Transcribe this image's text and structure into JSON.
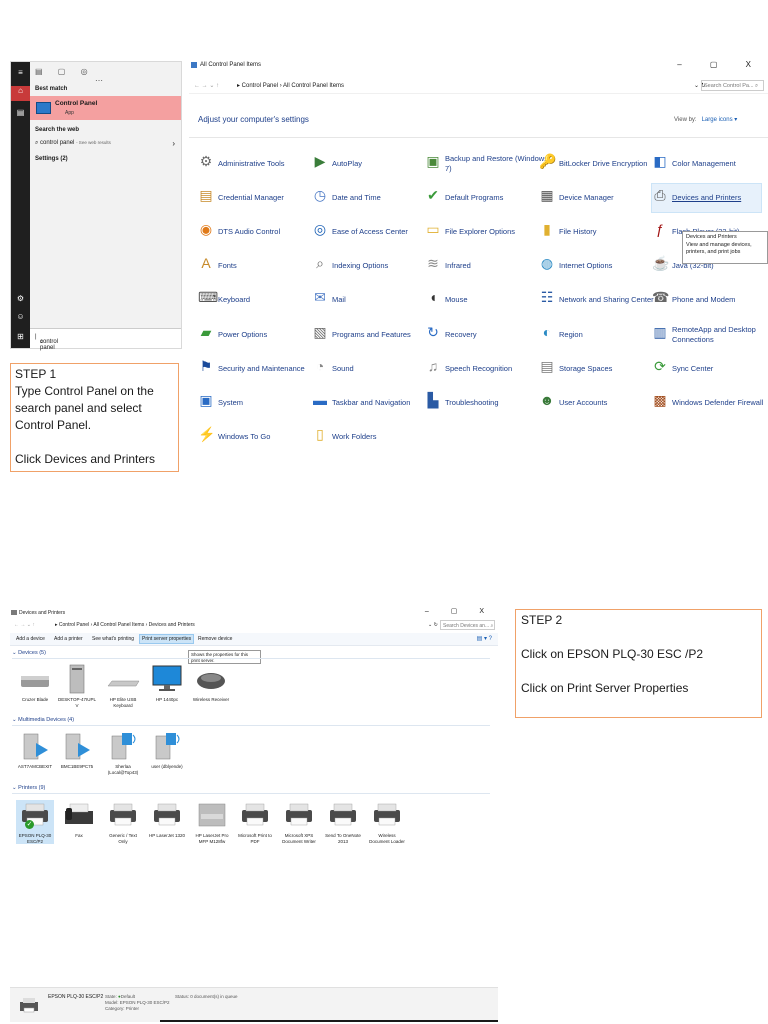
{
  "start_menu": {
    "top_icons": [
      "▤",
      "▢",
      "◎",
      "⋯"
    ],
    "best_match_label": "Best match",
    "best_match_title": "Control Panel",
    "best_match_sub": "App",
    "search_web_label": "Search the web",
    "web_result": "control panel",
    "web_result_sub": "- See web results",
    "settings_label": "Settings (2)",
    "search_value": "control panel"
  },
  "step1": {
    "heading": "STEP 1",
    "line1": "Type Control Panel on the search panel and select Control Panel.",
    "line2": "Click Devices and Printers"
  },
  "step2": {
    "heading": "STEP 2",
    "line1": "Click on  EPSON PLQ-30 ESC /P2",
    "line2": "Click on Print Server Properties"
  },
  "control_panel": {
    "window_title": "All Control Panel Items",
    "window_controls": "– ▢ X",
    "nav": "← → ⌄ ↑",
    "path": "▸ Control Panel › All Control Panel Items",
    "addr_controls": "⌄ ↻",
    "search_placeholder": "Search Control Pa... ⌕",
    "heading": "Adjust your computer's settings",
    "view_by_label": "View by:",
    "view_by_value": "Large icons ▾",
    "items": [
      {
        "label": "Administrative Tools",
        "glyph": "⚙",
        "color": "#6a6a6a"
      },
      {
        "label": "AutoPlay",
        "glyph": "▶",
        "color": "#3a7d3a"
      },
      {
        "label": "Backup and Restore (Windows 7)",
        "glyph": "▣",
        "color": "#4a8a3a"
      },
      {
        "label": "BitLocker Drive Encryption",
        "glyph": "🔑",
        "color": "#8a8a8a"
      },
      {
        "label": "Color Management",
        "glyph": "◧",
        "color": "#2a6bc4"
      },
      {
        "label": "Credential Manager",
        "glyph": "▤",
        "color": "#c78a2a"
      },
      {
        "label": "Date and Time",
        "glyph": "◷",
        "color": "#4a78c4"
      },
      {
        "label": "Default Programs",
        "glyph": "✔",
        "color": "#3a9a3a"
      },
      {
        "label": "Device Manager",
        "glyph": "▦",
        "color": "#555"
      },
      {
        "label": "Devices and Printers",
        "glyph": "⎙",
        "color": "#555"
      },
      {
        "label": "DTS Audio Control",
        "glyph": "◉",
        "color": "#e07a1a"
      },
      {
        "label": "Ease of Access Center",
        "glyph": "◎",
        "color": "#1a5fb4"
      },
      {
        "label": "File Explorer Options",
        "glyph": "▭",
        "color": "#e0b030"
      },
      {
        "label": "File History",
        "glyph": "▮",
        "color": "#e0b030"
      },
      {
        "label": "Flash Player (32-bit)",
        "glyph": "ƒ",
        "color": "#a01010"
      },
      {
        "label": "Fonts",
        "glyph": "A",
        "color": "#c78a2a"
      },
      {
        "label": "Indexing Options",
        "glyph": "⌕",
        "color": "#6a6a6a"
      },
      {
        "label": "Infrared",
        "glyph": "≋",
        "color": "#888"
      },
      {
        "label": "Internet Options",
        "glyph": "◍",
        "color": "#2a8ac4"
      },
      {
        "label": "Java (32-bit)",
        "glyph": "☕",
        "color": "#c04a1a"
      },
      {
        "label": "Keyboard",
        "glyph": "⌨",
        "color": "#555"
      },
      {
        "label": "Mail",
        "glyph": "✉",
        "color": "#4a78c4"
      },
      {
        "label": "Mouse",
        "glyph": "◖",
        "color": "#333"
      },
      {
        "label": "Network and Sharing Center",
        "glyph": "☷",
        "color": "#2a5aa4"
      },
      {
        "label": "Phone and Modem",
        "glyph": "☎",
        "color": "#666"
      },
      {
        "label": "Power Options",
        "glyph": "▰",
        "color": "#3a9a3a"
      },
      {
        "label": "Programs and Features",
        "glyph": "▧",
        "color": "#6a6a6a"
      },
      {
        "label": "Recovery",
        "glyph": "↻",
        "color": "#2a6bc4"
      },
      {
        "label": "Region",
        "glyph": "◐",
        "color": "#2a8ac4"
      },
      {
        "label": "RemoteApp and Desktop Connections",
        "glyph": "▥",
        "color": "#2a5aa4"
      },
      {
        "label": "Security and Maintenance",
        "glyph": "⚑",
        "color": "#1a4a9a"
      },
      {
        "label": "Sound",
        "glyph": "◔",
        "color": "#888"
      },
      {
        "label": "Speech Recognition",
        "glyph": "♫",
        "color": "#888"
      },
      {
        "label": "Storage Spaces",
        "glyph": "▤",
        "color": "#777"
      },
      {
        "label": "Sync Center",
        "glyph": "⟳",
        "color": "#3a9a3a"
      },
      {
        "label": "System",
        "glyph": "▣",
        "color": "#2a6bc4"
      },
      {
        "label": "Taskbar and Navigation",
        "glyph": "▬",
        "color": "#2a6bc4"
      },
      {
        "label": "Troubleshooting",
        "glyph": "▙",
        "color": "#2a5aa4"
      },
      {
        "label": "User Accounts",
        "glyph": "☻",
        "color": "#3a7a3a"
      },
      {
        "label": "Windows Defender Firewall",
        "glyph": "▩",
        "color": "#a04a1a"
      },
      {
        "label": "Windows To Go",
        "glyph": "⚡",
        "color": "#1a5fb4"
      },
      {
        "label": "Work Folders",
        "glyph": "▯",
        "color": "#e0b030"
      }
    ],
    "tooltip_title": "Devices and Printers",
    "tooltip_text": "View and manage devices, printers, and print jobs"
  },
  "devices_printers": {
    "window_title": "Devices and Printers",
    "window_controls": "– ▢ X",
    "nav": "← → ⌄ ↑",
    "path": "▸ Control Panel › All Control Panel Items › Devices and Printers",
    "addr_controls": "⌄ ↻",
    "search_placeholder": "Search Devices an... ⌕",
    "commands": [
      "Add a device",
      "Add a printer",
      "See what's printing",
      "Print server properties",
      "Remove device"
    ],
    "cmd_right": "▤ ▾   ?",
    "server_tip": "Shows the properties for this print server.",
    "groups": {
      "devices": "⌄ Devices (5)",
      "multimedia": "⌄ Multimedia Devices (4)",
      "printers": "⌄ Printers (9)"
    },
    "devices": [
      "Cruzer Blade",
      "DESKTOP-47IUPL V",
      "HP Elite USB Keyboard",
      "HP 1440pc",
      "Wireless Receiver"
    ],
    "multimedia": [
      "AST7AMCBEXIT",
      "BMC1BE9PC75",
      "Sherlaa (Local@Top43)",
      "user (dblyende)"
    ],
    "printers": [
      "EPSON PLQ-30 ESC/P2",
      "Fax",
      "Generic / Text Only",
      "HP LaserJet 1320",
      "HP LaserJet Pro MFP M128fw",
      "Microsoft Print to PDF",
      "Microsoft XPS Document Writer",
      "Send To OneNote 2013",
      "Wireless Document Loader"
    ],
    "status": {
      "name": "EPSON PLQ-30 ESC/P2",
      "state_label": "State:",
      "state": "Default",
      "status_label": "Status:",
      "status_value": "0 document(s) in queue",
      "model_label": "Model:",
      "model": "EPSON PLQ-30 ESC/P2",
      "category_label": "Category:",
      "category": "Printer"
    }
  }
}
